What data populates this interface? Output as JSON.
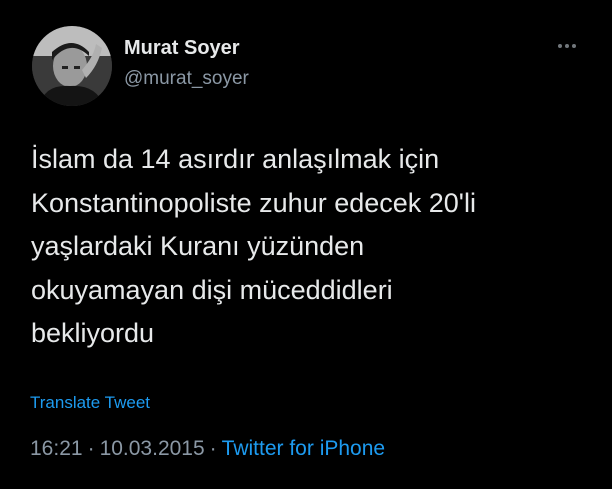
{
  "author": {
    "name": "Murat Soyer",
    "handle": "@murat_soyer"
  },
  "tweet": {
    "text_lines": [
      "İslam da 14 asırdır anlaşılmak için",
      "Konstantinopoliste zuhur edecek 20'li",
      "yaşlardaki Kuranı yüzünden",
      "okuyamayan dişi müceddidleri",
      "bekliyordu"
    ],
    "translate_label": "Translate Tweet",
    "time": "16:21",
    "separator": "·",
    "date": "10.03.2015",
    "source": "Twitter for iPhone"
  },
  "icons": {
    "more": "more-horizontal-icon",
    "avatar": "profile-photo"
  },
  "colors": {
    "background": "#000000",
    "text": "#e7e9ea",
    "secondary": "#8b98a5",
    "accent": "#1d9bf0"
  }
}
